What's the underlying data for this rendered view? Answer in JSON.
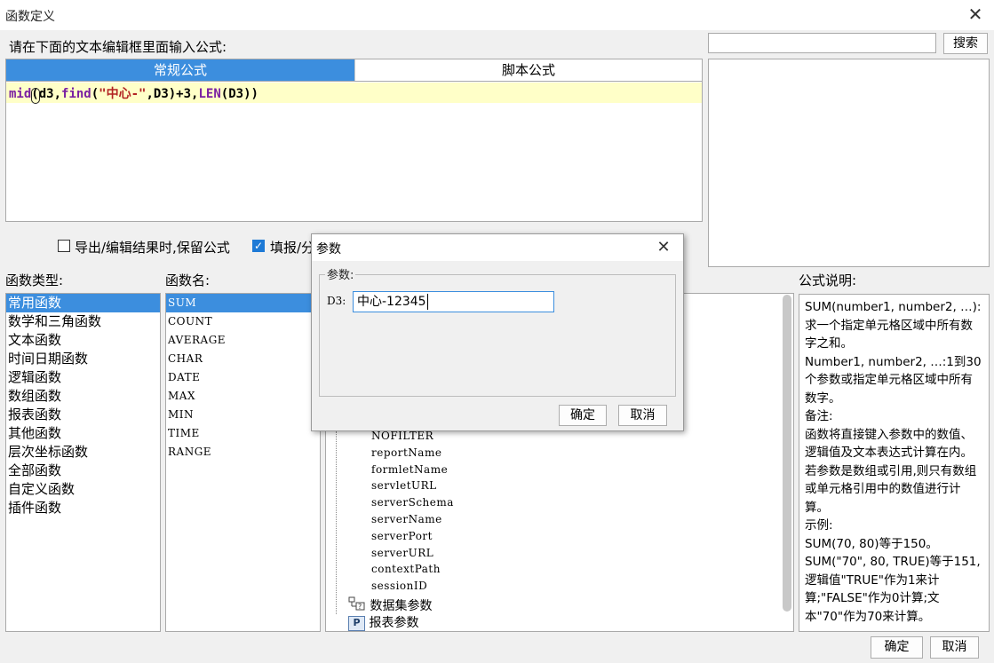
{
  "window": {
    "title": "函数定义"
  },
  "prompt": "请在下面的文本编辑框里面输入公式:",
  "search": {
    "value": "",
    "button": "搜索"
  },
  "tabs": [
    {
      "label": "常规公式",
      "active": true
    },
    {
      "label": "脚本公式",
      "active": false
    }
  ],
  "formula": {
    "fn1": "mid",
    "p1": "(d3,",
    "fn2": "find",
    "p2": "(",
    "str": "\"中心-\"",
    "p3": ",D3)+3,",
    "fn3": "LEN",
    "p4": "(D3))"
  },
  "options": [
    {
      "label": "导出/编辑结果时,保留公式",
      "checked": false
    },
    {
      "label": "填报/分",
      "checked": true
    }
  ],
  "labels": {
    "func_type": "函数类型:",
    "func_name": "函数名:",
    "formula_desc": "公式说明:"
  },
  "func_types": [
    "常用函数",
    "数学和三角函数",
    "文本函数",
    "时间日期函数",
    "逻辑函数",
    "数组函数",
    "报表函数",
    "其他函数",
    "层次坐标函数",
    "全部函数",
    "自定义函数",
    "插件函数"
  ],
  "func_names": [
    "SUM",
    "COUNT",
    "AVERAGE",
    "CHAR",
    "DATE",
    "MAX",
    "MIN",
    "TIME",
    "RANGE"
  ],
  "tree_items": [
    "NOFILTER",
    "reportName",
    "formletName",
    "servletURL",
    "serverSchema",
    "serverName",
    "serverPort",
    "serverURL",
    "contextPath",
    "sessionID"
  ],
  "tree_groups": [
    {
      "label": "数据集参数",
      "icon": "dataset-param-icon"
    },
    {
      "label": "报表参数",
      "icon": "report-param-icon",
      "glyph": "P"
    }
  ],
  "description": {
    "lines": [
      "SUM(number1, number2, …):求一个指定单元格区域中所有数字之和。",
      "Number1, number2, …:1到30个参数或指定单元格区域中所有数字。",
      "备注:",
      "函数将直接键入参数中的数值、逻辑值及文本表达式计算在内。若参数是数组或引用,则只有数组或单元格引用中的数值进行计算。",
      "示例:",
      "SUM(70, 80)等于150。",
      "SUM(\"70\", 80, TRUE)等于151,逻辑值\"TRUE\"作为1来计算;\"FALSE\"作为0计算;文本\"70\"作为70来计算。"
    ]
  },
  "buttons": {
    "ok": "确定",
    "cancel": "取消"
  },
  "dialog": {
    "title": "参数",
    "group": "参数:",
    "param_label": "D3:",
    "param_value": "中心-12345",
    "ok": "确定",
    "cancel": "取消"
  }
}
